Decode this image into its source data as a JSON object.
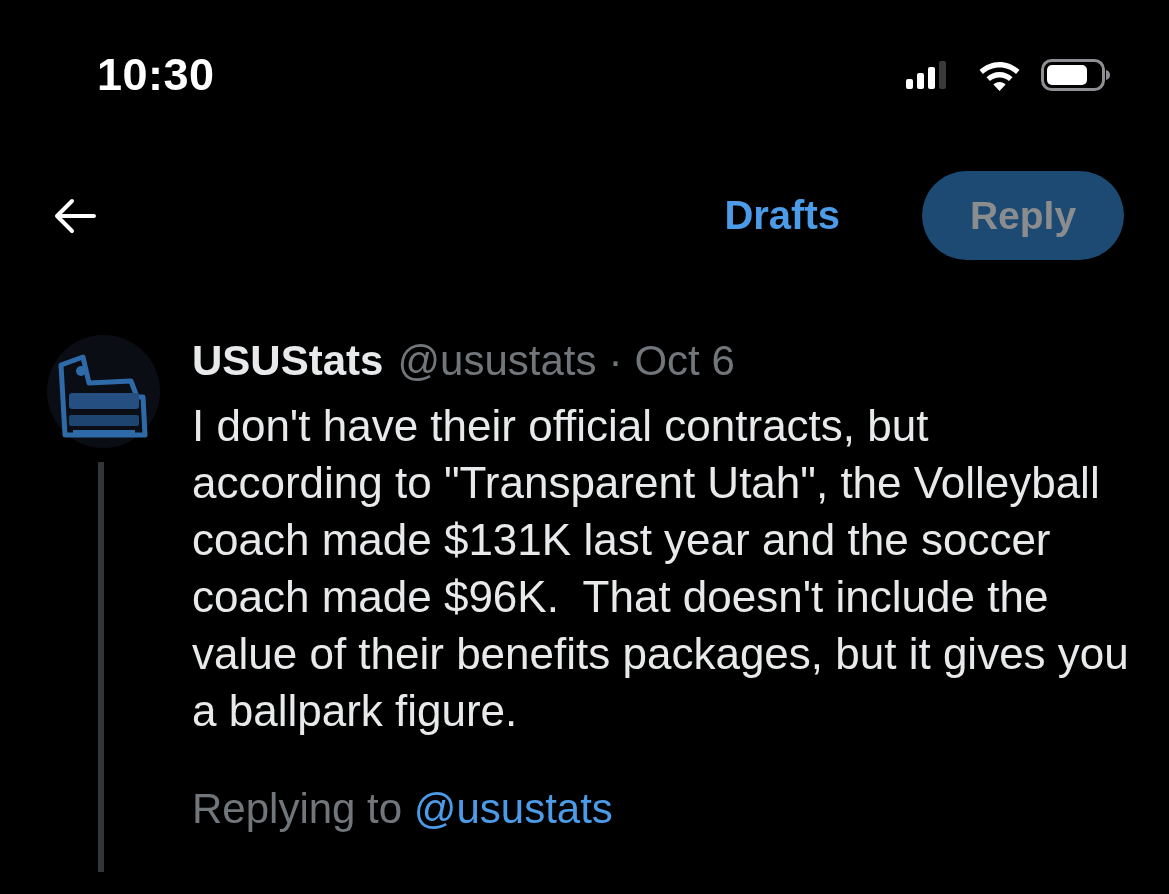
{
  "status_bar": {
    "time": "10:30"
  },
  "header": {
    "drafts_label": "Drafts",
    "reply_button": {
      "label": "Reply",
      "disabled": true
    }
  },
  "tweet": {
    "author": {
      "name": "USUStats",
      "handle": "@usustats"
    },
    "separator": "·",
    "date": "Oct 6",
    "text": "I don't have their official contracts, but\naccording to \"Transparent Utah\", the Volleyball coach made $131K last year and the soccer coach made $96K.  That doesn't include the value of their benefits packages, but it gives you a ballpark figure.",
    "replying_to": {
      "prefix": "Replying to",
      "handle": "@usustats"
    }
  }
}
